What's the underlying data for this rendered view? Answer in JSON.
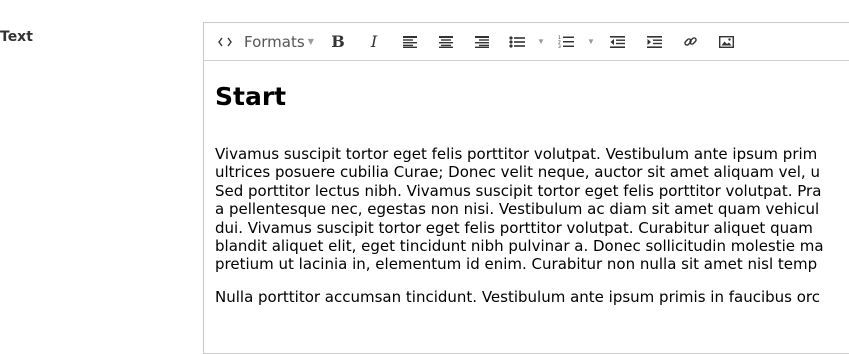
{
  "field": {
    "label": "Text"
  },
  "toolbar": {
    "formats_label": "Formats",
    "buttons": [
      "source-code",
      "formats",
      "bold",
      "italic",
      "align-left",
      "align-center",
      "align-right",
      "bullet-list",
      "numbered-list",
      "outdent",
      "indent",
      "link",
      "image"
    ]
  },
  "content": {
    "heading": "Start",
    "paragraph1_lines": [
      "Vivamus suscipit tortor eget felis porttitor volutpat. Vestibulum ante ipsum prim",
      "ultrices posuere cubilia Curae; Donec velit neque, auctor sit amet aliquam vel, u",
      "Sed porttitor lectus nibh. Vivamus suscipit tortor eget felis porttitor volutpat. Pra",
      "a pellentesque nec, egestas non nisi. Vestibulum ac diam sit amet quam vehicul",
      "dui. Vivamus suscipit tortor eget felis porttitor volutpat. Curabitur aliquet quam",
      "blandit aliquet elit, eget tincidunt nibh pulvinar a. Donec sollicitudin molestie ma",
      "pretium ut lacinia in, elementum id enim. Curabitur non nulla sit amet nisl temp"
    ],
    "paragraph2_lines": [
      "Nulla porttitor accumsan tincidunt. Vestibulum ante ipsum primis in faucibus orc"
    ]
  }
}
